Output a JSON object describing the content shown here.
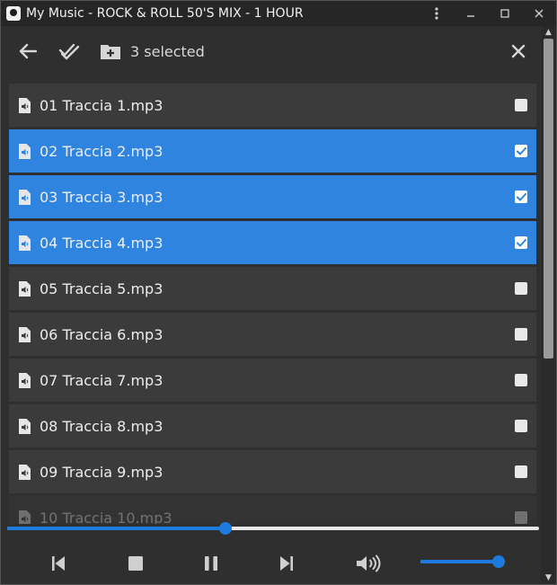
{
  "window": {
    "title": "My Music - ROCK & ROLL 50'S MIX - 1 HOUR"
  },
  "toolbar": {
    "selected_text": "3 selected"
  },
  "tracks": [
    {
      "name": "01 Traccia 1.mp3",
      "selected": false
    },
    {
      "name": "02 Traccia 2.mp3",
      "selected": true
    },
    {
      "name": "03 Traccia 3.mp3",
      "selected": true
    },
    {
      "name": "04 Traccia 4.mp3",
      "selected": true
    },
    {
      "name": "05 Traccia 5.mp3",
      "selected": false
    },
    {
      "name": "06 Traccia 6.mp3",
      "selected": false
    },
    {
      "name": "07 Traccia 7.mp3",
      "selected": false
    },
    {
      "name": "08 Traccia 8.mp3",
      "selected": false
    },
    {
      "name": "09 Traccia 9.mp3",
      "selected": false
    },
    {
      "name": "10 Traccia 10.mp3",
      "selected": false
    }
  ],
  "player": {
    "progress_fraction": 0.41,
    "volume_fraction": 0.93
  },
  "colors": {
    "accent": "#2f84e0",
    "row_bg": "#3b3b3b",
    "window_bg": "#2f2f2f"
  },
  "icons": {
    "back": "arrow-left-icon",
    "select_all": "double-check-icon",
    "add_folder": "folder-plus-icon",
    "close": "close-icon",
    "file": "audio-file-icon",
    "prev": "skip-previous-icon",
    "stop": "stop-icon",
    "pause": "pause-icon",
    "next": "skip-next-icon",
    "volume": "volume-icon"
  }
}
